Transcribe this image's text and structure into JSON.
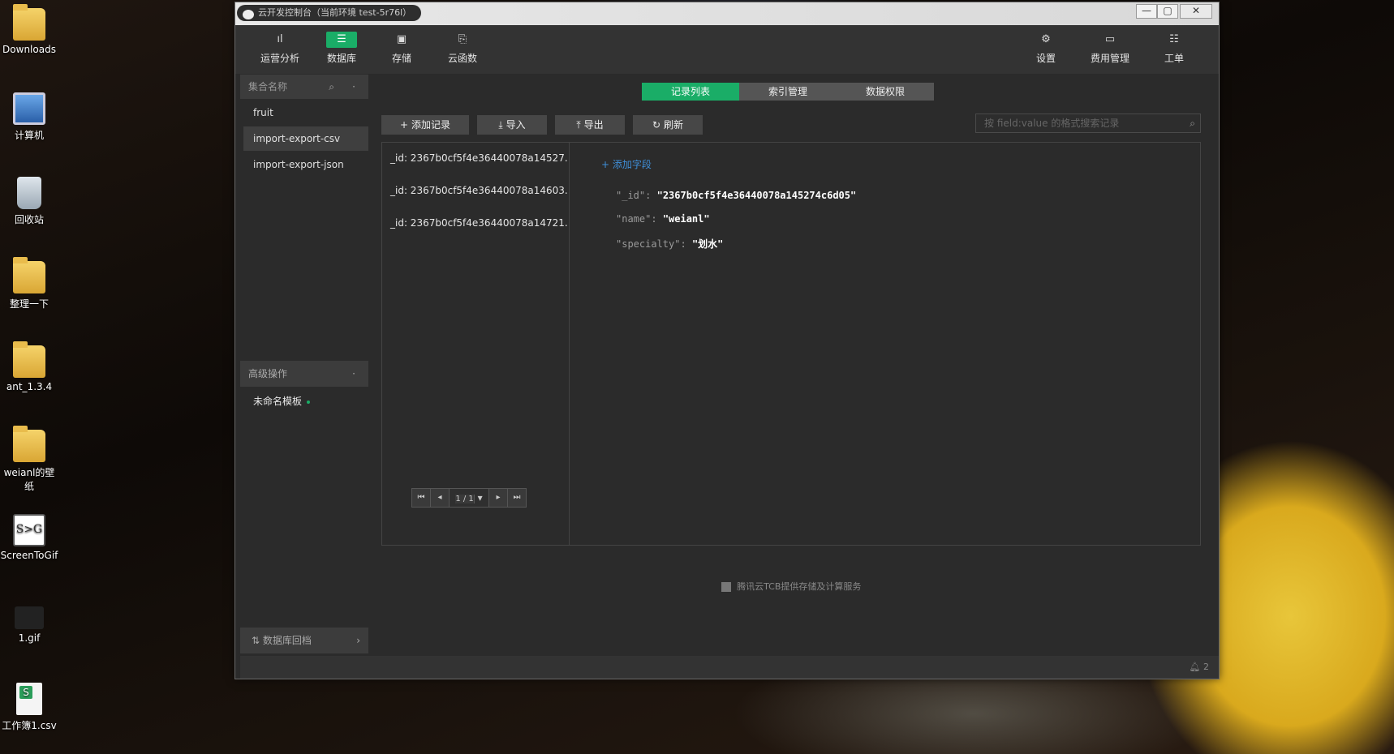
{
  "desktop": {
    "icons": [
      "Downloads",
      "计算机",
      "回收站",
      "整理一下",
      "ant_1.3.4",
      "weianl的壁纸",
      "ScreenToGif",
      "1.gif",
      "工作簿1.csv"
    ]
  },
  "window": {
    "title": "云开发控制台（当前环境 test-5r76l）",
    "controls": {
      "minimize": "—",
      "maximize": "▢",
      "close": "✕"
    }
  },
  "toolbar": {
    "left": [
      {
        "label": "运营分析",
        "icon": "bar-chart-icon",
        "glyph": "ıl"
      },
      {
        "label": "数据库",
        "icon": "database-icon",
        "glyph": "☰"
      },
      {
        "label": "存储",
        "icon": "storage-icon",
        "glyph": "▣"
      },
      {
        "label": "云函数",
        "icon": "function-icon",
        "glyph": "⎘"
      }
    ],
    "right": [
      {
        "label": "设置",
        "icon": "gear-icon",
        "glyph": "⚙"
      },
      {
        "label": "费用管理",
        "icon": "billing-icon",
        "glyph": "▭"
      },
      {
        "label": "工单",
        "icon": "ticket-icon",
        "glyph": "☷"
      }
    ],
    "active_index": 1
  },
  "sidebar": {
    "collection_header": "集合名称",
    "collections": [
      "fruit",
      "import-export-csv",
      "import-export-json"
    ],
    "active_collection": 1,
    "advanced_header": "高级操作",
    "advanced_items": [
      "未命名模板"
    ],
    "rollback_label": "数据库回档"
  },
  "main": {
    "tabs": [
      "记录列表",
      "索引管理",
      "数据权限"
    ],
    "active_tab": 0,
    "actions": [
      {
        "label": "添加记录",
        "glyph": "+"
      },
      {
        "label": "导入",
        "glyph": "⤓"
      },
      {
        "label": "导出",
        "glyph": "⤒"
      },
      {
        "label": "刷新",
        "glyph": "↻"
      }
    ],
    "search_placeholder": "按 field:value 的格式搜索记录",
    "records": [
      "_id: 2367b0cf5f4e36440078a14527...",
      "_id: 2367b0cf5f4e36440078a14603...",
      "_id: 2367b0cf5f4e36440078a14721..."
    ],
    "pager": {
      "page": "1 / 1"
    },
    "add_field_label": "添加字段",
    "fields": [
      {
        "key": "\"_id\":",
        "value": "\"2367b0cf5f4e36440078a145274c6d05\""
      },
      {
        "key": "\"name\":",
        "value": "\"weianl\""
      },
      {
        "key": "\"specialty\":",
        "value": "\"划水\""
      }
    ],
    "footer_note": "腾讯云TCB提供存储及计算服务"
  },
  "statusbar": {
    "notifications": "2"
  },
  "colors": {
    "accent": "#1aad67",
    "link": "#3f8fd8",
    "bg": "#2b2b2b"
  }
}
